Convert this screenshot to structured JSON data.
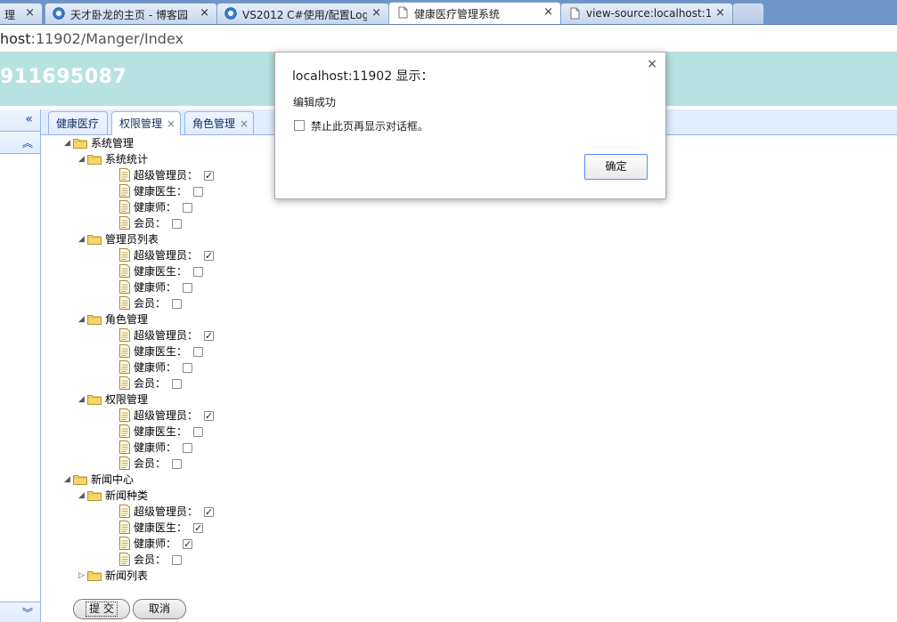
{
  "browser": {
    "tabs": [
      {
        "title": "理",
        "active": false
      },
      {
        "title": "天才卧龙的主页 - 博客园",
        "active": false
      },
      {
        "title": "VS2012 C#使用/配置Log",
        "active": false
      },
      {
        "title": "健康医疗管理系统",
        "active": true
      },
      {
        "title": "view-source:localhost:11",
        "active": false
      }
    ],
    "close_glyph": "×",
    "url_host": "host",
    "url_rest": ":11902/Manger/Index"
  },
  "app": {
    "header_title": "911695087"
  },
  "left_panel": {
    "collapse_glyph": "«",
    "up_glyph": "︽",
    "down_glyph": "︾"
  },
  "content_tabs": [
    {
      "label": "健康医疗",
      "closable": false
    },
    {
      "label": "权限管理",
      "closable": true,
      "active": true
    },
    {
      "label": "角色管理",
      "closable": true
    }
  ],
  "tab_close_glyph": "×",
  "tree": {
    "expanded_glyph": "◢",
    "collapsed_glyph": "▷",
    "check_glyph": "✓",
    "groups": [
      {
        "label": "系统管理",
        "children": [
          {
            "label": "系统统计",
            "roles": [
              {
                "label": "超级管理员：",
                "checked": true
              },
              {
                "label": "健康医生：",
                "checked": false
              },
              {
                "label": "健康师：",
                "checked": false
              },
              {
                "label": "会员：",
                "checked": false
              }
            ]
          },
          {
            "label": "管理员列表",
            "roles": [
              {
                "label": "超级管理员：",
                "checked": true
              },
              {
                "label": "健康医生：",
                "checked": false
              },
              {
                "label": "健康师：",
                "checked": false
              },
              {
                "label": "会员：",
                "checked": false
              }
            ]
          },
          {
            "label": "角色管理",
            "roles": [
              {
                "label": "超级管理员：",
                "checked": true
              },
              {
                "label": "健康医生：",
                "checked": false
              },
              {
                "label": "健康师：",
                "checked": false
              },
              {
                "label": "会员：",
                "checked": false
              }
            ]
          },
          {
            "label": "权限管理",
            "roles": [
              {
                "label": "超级管理员：",
                "checked": true
              },
              {
                "label": "健康医生：",
                "checked": false
              },
              {
                "label": "健康师：",
                "checked": false
              },
              {
                "label": "会员：",
                "checked": false
              }
            ]
          }
        ]
      },
      {
        "label": "新闻中心",
        "children": [
          {
            "label": "新闻种类",
            "roles": [
              {
                "label": "超级管理员：",
                "checked": true
              },
              {
                "label": "健康医生：",
                "checked": true
              },
              {
                "label": "健康师：",
                "checked": true
              },
              {
                "label": "会员：",
                "checked": false
              }
            ]
          },
          {
            "label": "新闻列表",
            "collapsed": true,
            "roles": []
          }
        ]
      }
    ]
  },
  "form": {
    "submit_label": "提 交",
    "cancel_label": "取消"
  },
  "dialog": {
    "title": "localhost:11902 显示：",
    "close_glyph": "×",
    "message": "编辑成功",
    "suppress_label": "禁止此页再显示对话框。",
    "ok_label": "确定"
  },
  "colors": {
    "header_bg": "#b6e2e2",
    "panel_border": "#95b8e7",
    "tab_strip": "#6d95c8"
  }
}
